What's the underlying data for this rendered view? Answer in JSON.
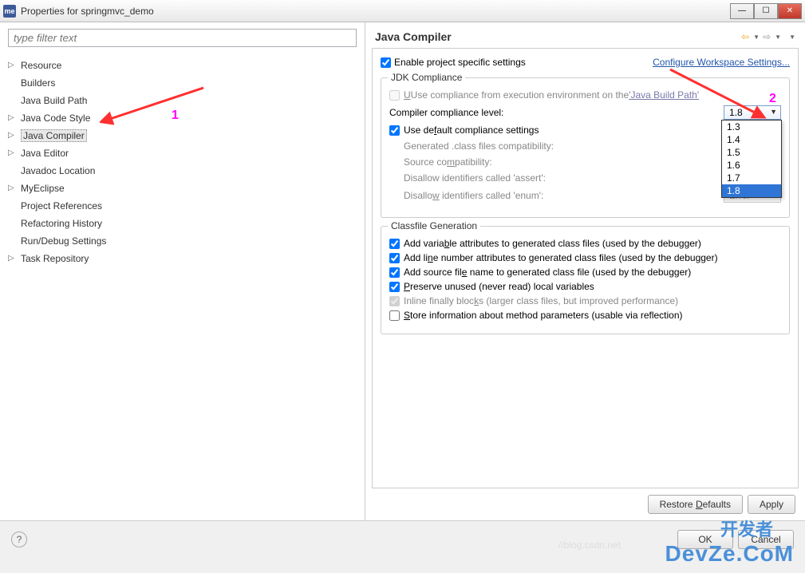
{
  "window": {
    "title": "Properties for springmvc_demo",
    "icon_text": "me"
  },
  "filter": {
    "placeholder": "type filter text"
  },
  "tree": {
    "items": [
      {
        "label": "Resource",
        "expandable": true,
        "selected": false
      },
      {
        "label": "Builders",
        "expandable": false,
        "selected": false
      },
      {
        "label": "Java Build Path",
        "expandable": false,
        "selected": false
      },
      {
        "label": "Java Code Style",
        "expandable": true,
        "selected": false
      },
      {
        "label": "Java Compiler",
        "expandable": true,
        "selected": true
      },
      {
        "label": "Java Editor",
        "expandable": true,
        "selected": false
      },
      {
        "label": "Javadoc Location",
        "expandable": false,
        "selected": false
      },
      {
        "label": "MyEclipse",
        "expandable": true,
        "selected": false
      },
      {
        "label": "Project References",
        "expandable": false,
        "selected": false
      },
      {
        "label": "Refactoring History",
        "expandable": false,
        "selected": false
      },
      {
        "label": "Run/Debug Settings",
        "expandable": false,
        "selected": false
      },
      {
        "label": "Task Repository",
        "expandable": true,
        "selected": false
      }
    ]
  },
  "right": {
    "title": "Java Compiler",
    "enable_project_settings": "Enable project specific settings",
    "configure_workspace": "Configure Workspace Settings...",
    "jdk_section": "JDK Compliance",
    "use_from_env_pre": "Use compliance from execution environment on the ",
    "java_build_path_link": "'Java Build Path'",
    "compiler_level_label": "Compiler compliance level:",
    "compiler_level_value": "1.8",
    "compiler_level_options": [
      "1.3",
      "1.4",
      "1.5",
      "1.6",
      "1.7",
      "1.8"
    ],
    "use_default_compliance": "Use default compliance settings",
    "gen_class_compat": "Generated .class files compatibility:",
    "source_compat": "Source compatibility:",
    "disallow_assert": "Disallow identifiers called 'assert':",
    "disallow_enum": "Disallow identifiers called 'enum':",
    "error_value": "Error",
    "classfile_section": "Classfile Generation",
    "add_var_attrs": "Add variable attributes to generated class files (used by the debugger)",
    "add_line_num": "Add line number attributes to generated class files (used by the debugger)",
    "add_src_file": "Add source file name to generated class file (used by the debugger)",
    "preserve_unused": "Preserve unused (never read) local variables",
    "inline_finally": "Inline finally blocks (larger class files, but improved performance)",
    "store_method_params": "Store information about method parameters (usable via reflection)"
  },
  "buttons": {
    "restore_defaults": "Restore Defaults",
    "apply": "Apply",
    "ok": "OK",
    "cancel": "Cancel"
  },
  "annotations": {
    "num1": "1",
    "num2": "2"
  },
  "watermark": {
    "cn": "开发者",
    "en": "DevZe.CoM",
    "faint": "//blog.csdn.net"
  }
}
